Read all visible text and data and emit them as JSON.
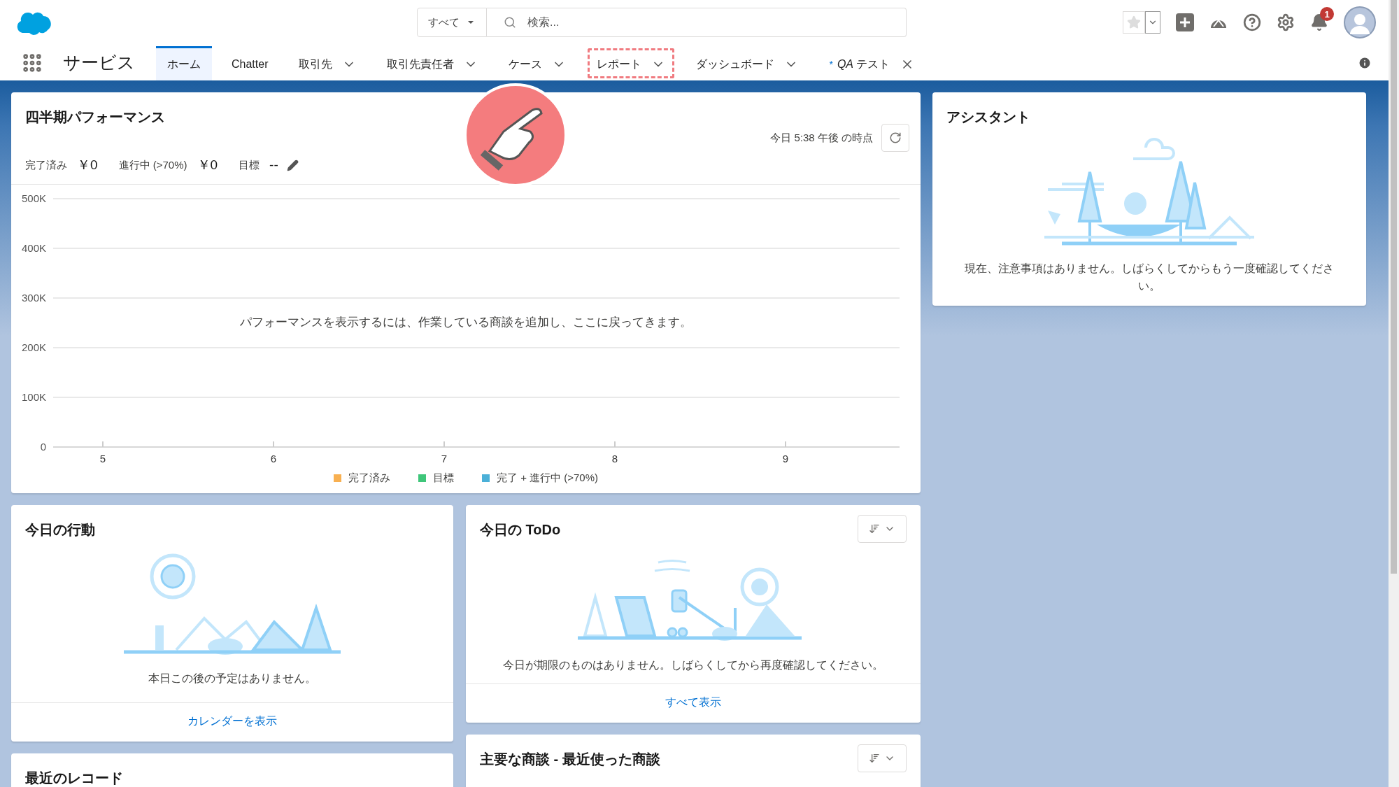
{
  "header": {
    "search": {
      "scope": "すべて",
      "placeholder": "検索..."
    },
    "notifications": {
      "count": "1"
    }
  },
  "nav": {
    "app_name": "サービス",
    "tabs": [
      {
        "label": "ホーム",
        "selected": true,
        "menu": false,
        "closable": false,
        "highlighted": false
      },
      {
        "label": "Chatter",
        "selected": false,
        "menu": false,
        "closable": false,
        "highlighted": false
      },
      {
        "label": "取引先",
        "selected": false,
        "menu": true,
        "closable": false,
        "highlighted": false
      },
      {
        "label": "取引先責任者",
        "selected": false,
        "menu": true,
        "closable": false,
        "highlighted": false
      },
      {
        "label": "ケース",
        "selected": false,
        "menu": true,
        "closable": false,
        "highlighted": false
      },
      {
        "label": "レポート",
        "selected": false,
        "menu": true,
        "closable": false,
        "highlighted": true
      },
      {
        "label": "ダッシュボード",
        "selected": false,
        "menu": true,
        "closable": false,
        "highlighted": false
      },
      {
        "prefix": "*",
        "label": "*QA* テスト",
        "selected": false,
        "menu": false,
        "closable": true,
        "highlighted": false
      }
    ]
  },
  "performance": {
    "title": "四半期パフォーマンス",
    "as_of": "今日 5:38 午後 の時点",
    "metrics": [
      {
        "label": "完了済み",
        "value": "￥0"
      },
      {
        "label": "進行中 (>70%)",
        "value": "￥0"
      },
      {
        "label": "目標",
        "value": "--",
        "editable": true
      }
    ],
    "empty_message": "パフォーマンスを表示するには、作業している商談を追加し、ここに戻ってきます。",
    "chart_data": {
      "type": "line",
      "grid": true,
      "categories": [
        "5",
        "6",
        "7",
        "8",
        "9"
      ],
      "ylim": [
        0,
        500000
      ],
      "yticks": [
        {
          "value": 0,
          "label": "0"
        },
        {
          "value": 100000,
          "label": "100K"
        },
        {
          "value": 200000,
          "label": "200K"
        },
        {
          "value": 300000,
          "label": "300K"
        },
        {
          "value": 400000,
          "label": "400K"
        },
        {
          "value": 500000,
          "label": "500K"
        }
      ]
    },
    "legend": [
      {
        "label": "完了済み",
        "color": "#f8b051"
      },
      {
        "label": "目標",
        "color": "#3fc67a"
      },
      {
        "label": "完了 + 進行中 (>70%)",
        "color": "#4bb0d8"
      }
    ]
  },
  "assistant": {
    "title": "アシスタント",
    "message": "現在、注意事項はありません。しばらくしてからもう一度確認してください。"
  },
  "events": {
    "title": "今日の行動",
    "message": "本日この後の予定はありません。",
    "link": "カレンダーを表示"
  },
  "todo": {
    "title": "今日の ToDo",
    "message": "今日が期限のものはありません。しばらくしてから再度確認してください。",
    "link": "すべて表示"
  },
  "recent_records": {
    "title": "最近のレコード"
  },
  "key_deals": {
    "title": "主要な商談 - 最近使った商談"
  }
}
